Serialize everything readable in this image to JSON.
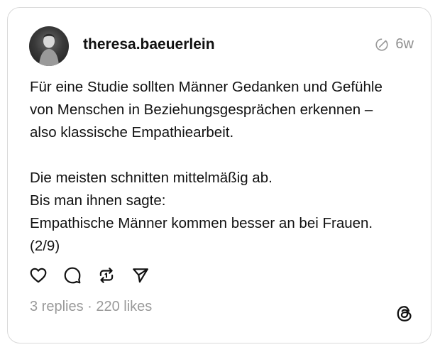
{
  "post": {
    "username": "theresa.baeuerlein",
    "time_ago": "6w",
    "text_lines_1": [
      "Für eine Studie sollten Männer Gedanken und Gefühle",
      "von Menschen in Beziehungsgesprächen erkennen –",
      "also klassische Empathiearbeit."
    ],
    "text_lines_2": [
      "Die meisten schnitten mittelmäßig ab.",
      "Bis man ihnen sagte:",
      "Empathische Männer kommen besser an bei Frauen.",
      "(2/9)"
    ],
    "stats": "3 replies · 220 likes"
  },
  "icons": {
    "avatar": "avatar",
    "meta": "threads-draw-icon",
    "like": "heart-icon",
    "reply": "comment-icon",
    "repost": "repost-icon",
    "share": "send-icon",
    "brand": "threads-logo-icon"
  },
  "colors": {
    "text": "#111111",
    "muted": "#999999",
    "border": "#d9d9d9"
  }
}
